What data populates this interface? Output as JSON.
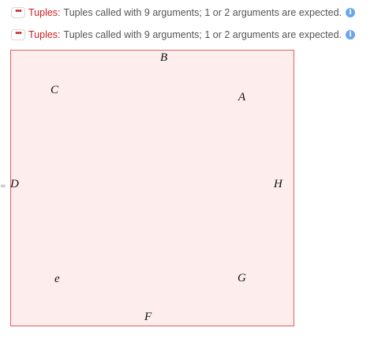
{
  "messages": [
    {
      "ellipsis": "•••",
      "head": "Tuples:",
      "text": "Tuples called with 9 arguments; 1 or 2 arguments are expected.",
      "info_icon": "i"
    },
    {
      "ellipsis": "•••",
      "head": "Tuples:",
      "text": "Tuples called with 9 arguments; 1 or 2 arguments are expected.",
      "info_icon": "i"
    }
  ],
  "output": {
    "eq_mark": "=",
    "labels": {
      "A": "A",
      "B": "B",
      "C": "C",
      "D": "D",
      "e": "e",
      "F": "F",
      "G": "G",
      "H": "H"
    }
  },
  "colors": {
    "message_head": "#cc1f1f",
    "message_text": "#555555",
    "info_icon": "#6aa6e8",
    "frame_fill": "#fdeded",
    "frame_border": "#e36060"
  }
}
